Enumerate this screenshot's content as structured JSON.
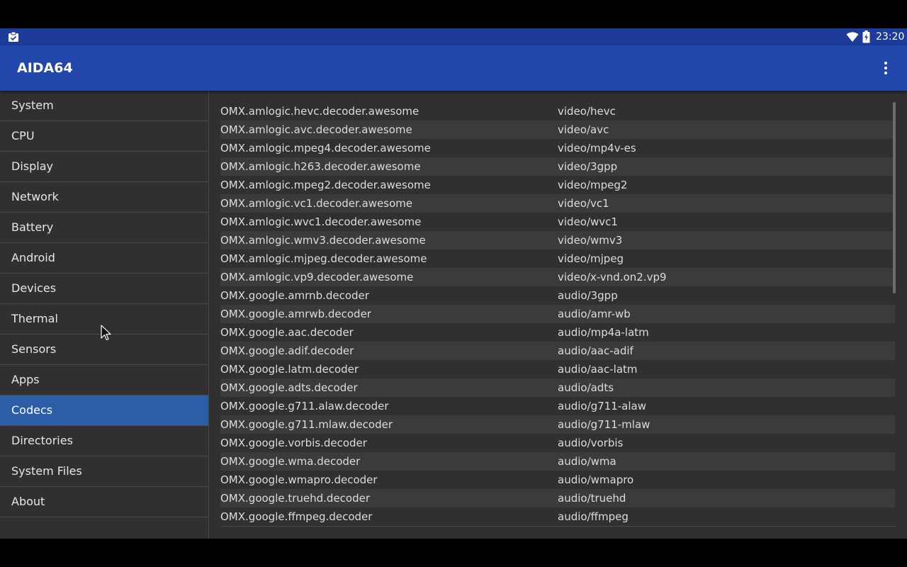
{
  "status": {
    "time": "23:20"
  },
  "app": {
    "title": "AIDA64"
  },
  "sidebar": {
    "items": [
      {
        "label": "System"
      },
      {
        "label": "CPU"
      },
      {
        "label": "Display"
      },
      {
        "label": "Network"
      },
      {
        "label": "Battery"
      },
      {
        "label": "Android"
      },
      {
        "label": "Devices"
      },
      {
        "label": "Thermal"
      },
      {
        "label": "Sensors"
      },
      {
        "label": "Apps"
      },
      {
        "label": "Codecs"
      },
      {
        "label": "Directories"
      },
      {
        "label": "System Files"
      },
      {
        "label": "About"
      }
    ],
    "active_index": 10
  },
  "codecs": [
    {
      "name": "OMX.amlogic.hevc.decoder.awesome",
      "type": "video/hevc"
    },
    {
      "name": "OMX.amlogic.avc.decoder.awesome",
      "type": "video/avc"
    },
    {
      "name": "OMX.amlogic.mpeg4.decoder.awesome",
      "type": "video/mp4v-es"
    },
    {
      "name": "OMX.amlogic.h263.decoder.awesome",
      "type": "video/3gpp"
    },
    {
      "name": "OMX.amlogic.mpeg2.decoder.awesome",
      "type": "video/mpeg2"
    },
    {
      "name": "OMX.amlogic.vc1.decoder.awesome",
      "type": "video/vc1"
    },
    {
      "name": "OMX.amlogic.wvc1.decoder.awesome",
      "type": "video/wvc1"
    },
    {
      "name": "OMX.amlogic.wmv3.decoder.awesome",
      "type": "video/wmv3"
    },
    {
      "name": "OMX.amlogic.mjpeg.decoder.awesome",
      "type": "video/mjpeg"
    },
    {
      "name": "OMX.amlogic.vp9.decoder.awesome",
      "type": "video/x-vnd.on2.vp9"
    },
    {
      "name": "OMX.google.amrnb.decoder",
      "type": "audio/3gpp"
    },
    {
      "name": "OMX.google.amrwb.decoder",
      "type": "audio/amr-wb"
    },
    {
      "name": "OMX.google.aac.decoder",
      "type": "audio/mp4a-latm"
    },
    {
      "name": "OMX.google.adif.decoder",
      "type": "audio/aac-adif"
    },
    {
      "name": "OMX.google.latm.decoder",
      "type": "audio/aac-latm"
    },
    {
      "name": "OMX.google.adts.decoder",
      "type": "audio/adts"
    },
    {
      "name": "OMX.google.g711.alaw.decoder",
      "type": "audio/g711-alaw"
    },
    {
      "name": "OMX.google.g711.mlaw.decoder",
      "type": "audio/g711-mlaw"
    },
    {
      "name": "OMX.google.vorbis.decoder",
      "type": "audio/vorbis"
    },
    {
      "name": "OMX.google.wma.decoder",
      "type": "audio/wma"
    },
    {
      "name": "OMX.google.wmapro.decoder",
      "type": "audio/wmapro"
    },
    {
      "name": "OMX.google.truehd.decoder",
      "type": "audio/truehd"
    },
    {
      "name": "OMX.google.ffmpeg.decoder",
      "type": "audio/ffmpeg"
    }
  ],
  "icons": {
    "notification": "clipboard-check-icon",
    "wifi": "wifi-icon",
    "battery": "battery-charging-icon",
    "overflow": "more-vert-icon",
    "cursor": "mouse-pointer-icon"
  },
  "colors": {
    "status_bar": "#1c3b9a",
    "app_bar": "#2247aa",
    "active_item": "#2b5ea7",
    "background": "#303030"
  }
}
